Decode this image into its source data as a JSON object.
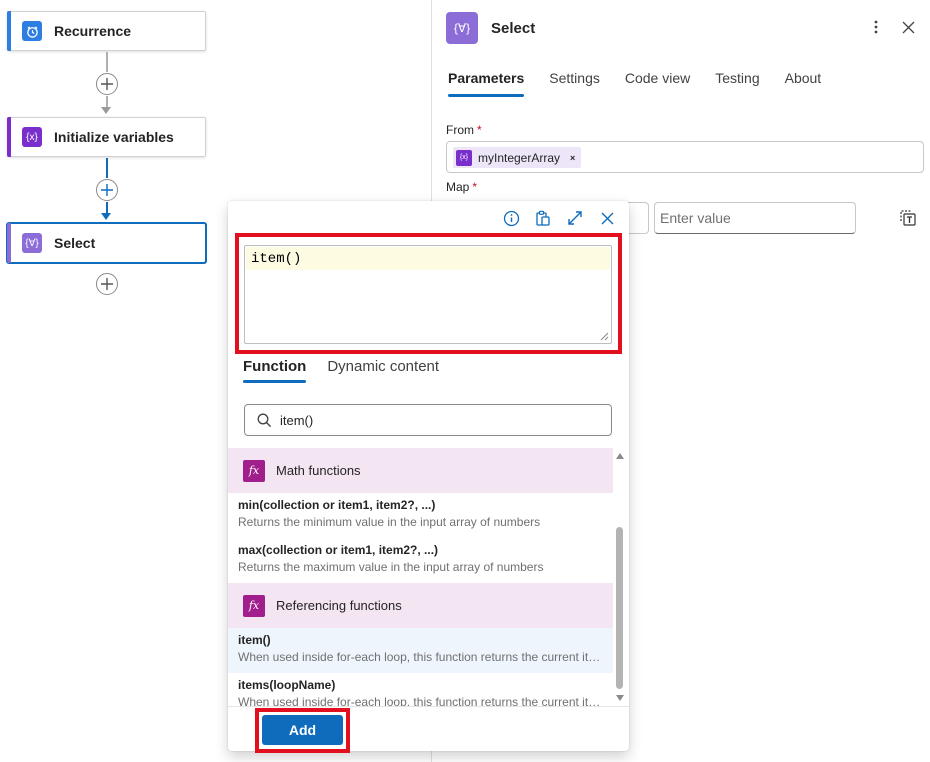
{
  "designer": {
    "nodes": [
      {
        "label": "Recurrence",
        "icon": "clock-icon",
        "accent": "#2e7de0"
      },
      {
        "label": "Initialize variables",
        "icon": "variable-icon",
        "accent": "#7a2ecc"
      },
      {
        "label": "Select",
        "icon": "data-operation-icon",
        "accent": "#8c6cd6"
      }
    ]
  },
  "panel": {
    "title": "Select",
    "icon": "data-operation-icon",
    "tabs": [
      "Parameters",
      "Settings",
      "Code view",
      "Testing",
      "About"
    ],
    "active_tab": "Parameters",
    "from": {
      "label": "From",
      "required_mark": "*",
      "token": "myIntegerArray",
      "token_icon": "variable-icon"
    },
    "map": {
      "label": "Map",
      "required_mark": "*",
      "value_placeholder": "Enter value"
    }
  },
  "expression_editor": {
    "expression": "item()",
    "tabs": [
      "Function",
      "Dynamic content"
    ],
    "active_tab": "Function",
    "search_value": "item()",
    "groups": [
      {
        "name": "Math functions",
        "icon": "fx",
        "items": [
          {
            "name": "min(collection or item1, item2?, ...)",
            "desc": "Returns the minimum value in the input array of numbers"
          },
          {
            "name": "max(collection or item1, item2?, ...)",
            "desc": "Returns the maximum value in the input array of numbers"
          }
        ]
      },
      {
        "name": "Referencing functions",
        "icon": "fx",
        "items": [
          {
            "name": "item()",
            "desc": "When used inside for-each loop, this function returns the current item of the array."
          },
          {
            "name": "items(loopName)",
            "desc": "When used inside for-each loop, this function returns the current item of the specified loop."
          }
        ]
      }
    ],
    "add_label": "Add"
  },
  "colors": {
    "accent_blue": "#0f6cbd",
    "highlight_red": "#e2101f",
    "fx_magenta": "#a01f8c"
  }
}
